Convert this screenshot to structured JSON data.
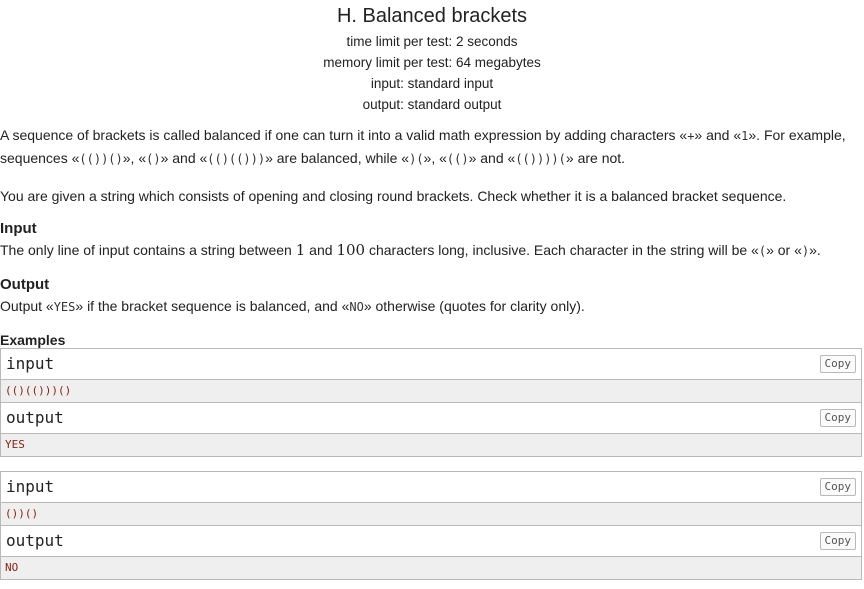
{
  "title": "H. Balanced brackets",
  "limits": {
    "time": "time limit per test: 2 seconds",
    "memory": "memory limit per test: 64 megabytes",
    "input": "input: standard input",
    "output": "output: standard output"
  },
  "statement": {
    "p1a": "A sequence of brackets is called balanced if one can turn it into a valid math expression by adding characters «",
    "plus": "+",
    "p1b": "» and «",
    "one": "1",
    "p1c": "». For example, sequences «",
    "ex1": "(())()",
    "p1d": "», «",
    "ex2": "()",
    "p1e": "» and «",
    "ex3": "(()(()))",
    "p1f": "» are balanced, while «",
    "ex4": ")(",
    "p1g": "», «",
    "ex5": "(()",
    "p1h": "» and «",
    "ex6": "(())))(",
    "p1i": "» are not.",
    "p2": "You are given a string which consists of opening and closing round brackets. Check whether it is a balanced bracket sequence."
  },
  "input_section": {
    "heading": "Input",
    "a": "The only line of input contains a string between ",
    "n1": "1",
    "b": " and ",
    "n2": "100",
    "c": " characters long, inclusive. Each character in the string will be «",
    "ch1": "(",
    "d": "» or «",
    "ch2": ")",
    "e": "»."
  },
  "output_section": {
    "heading": "Output",
    "a": "Output «",
    "yes": "YES",
    "b": "» if the bracket sequence is balanced, and «",
    "no": "NO",
    "c": "» otherwise (quotes for clarity only)."
  },
  "examples": {
    "heading": "Examples",
    "input_label": "input",
    "output_label": "output",
    "copy_label": "Copy",
    "ex1_input": "(()(()))()",
    "ex1_output": "YES",
    "ex2_input": "())()",
    "ex2_output": "NO"
  }
}
